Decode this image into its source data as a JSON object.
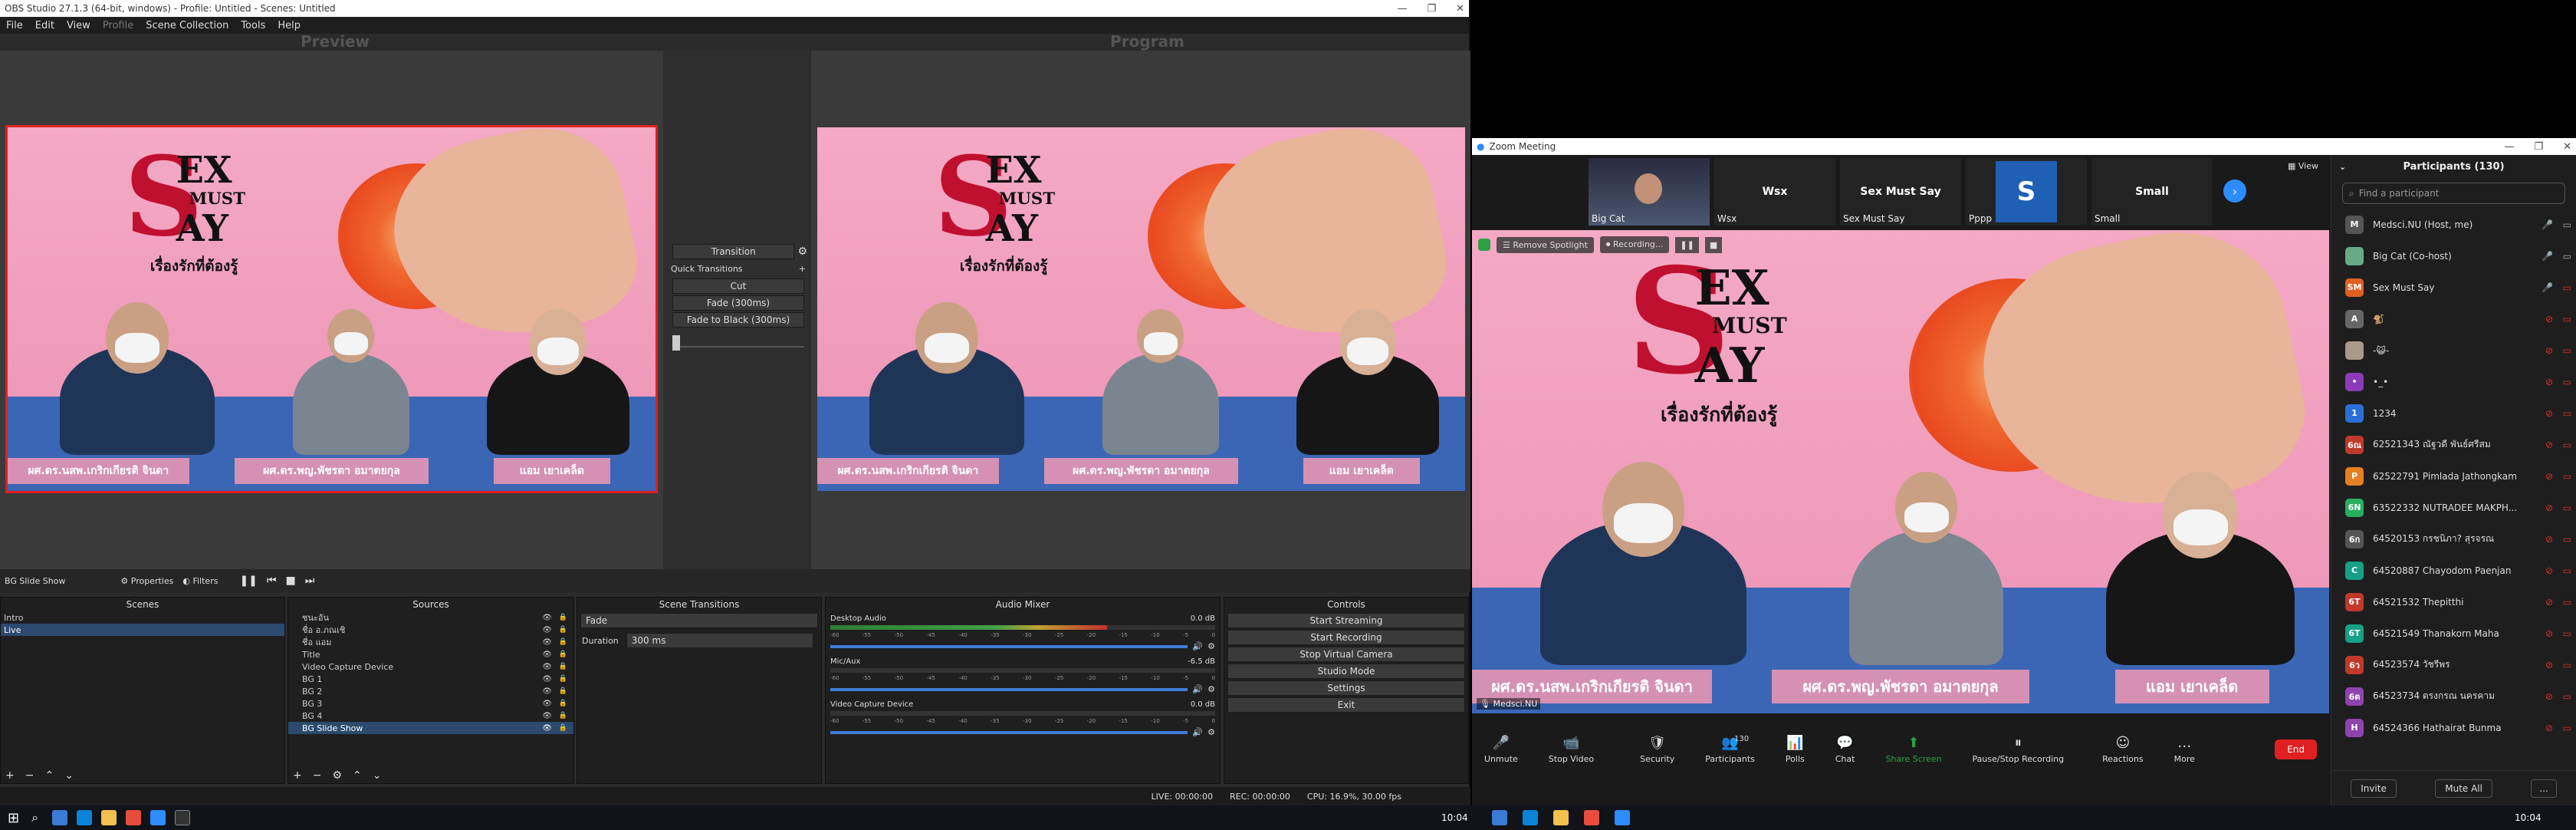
{
  "obs": {
    "window_title": "OBS Studio 27.1.3 (64-bit, windows) - Profile: Untitled - Scenes: Untitled",
    "menu": [
      "File",
      "Edit",
      "View",
      "Profile",
      "Scene Collection",
      "Tools",
      "Help"
    ],
    "preview_label": "Preview",
    "program_label": "Program",
    "transition_panel": {
      "transition_label": "Transition",
      "quick_transitions_label": "Quick Transitions",
      "cut_label": "Cut",
      "fade_label": "Fade (300ms)",
      "fade_black_label": "Fade to Black (300ms)"
    },
    "source_toolbar": {
      "source_name": "BG Slide Show",
      "properties_label": "Properties",
      "filters_label": "Filters"
    },
    "scenes": {
      "title": "Scenes",
      "items": [
        "Intro",
        "Live"
      ],
      "selected": 1
    },
    "sources": {
      "title": "Sources",
      "items": [
        "ชนะอัน",
        "ชื่อ อ.ภณเชิ",
        "ชื่อ แอม",
        "Title",
        "Video Capture Device",
        "BG 1",
        "BG 2",
        "BG 3",
        "BG 4",
        "BG Slide Show"
      ],
      "selected": 9
    },
    "scene_transitions": {
      "title": "Scene Transitions",
      "type": "Fade",
      "duration_label": "Duration",
      "duration_value": "300 ms"
    },
    "audio_mixer": {
      "title": "Audio Mixer",
      "channels": [
        {
          "name": "Desktop Audio",
          "db": "0.0 dB",
          "level": 0.72
        },
        {
          "name": "Mic/Aux",
          "db": "-6.5 dB",
          "level": 0.0
        },
        {
          "name": "Video Capture Device",
          "db": "0.0 dB",
          "level": 0.0
        }
      ],
      "ticks": [
        "-60",
        "-55",
        "-50",
        "-45",
        "-40",
        "-35",
        "-30",
        "-25",
        "-20",
        "-15",
        "-10",
        "-5",
        "0"
      ]
    },
    "controls": {
      "title": "Controls",
      "buttons": [
        "Start Streaming",
        "Start Recording",
        "Stop Virtual Camera",
        "Studio Mode",
        "Settings",
        "Exit"
      ]
    },
    "status": {
      "live": "LIVE: 00:00:00",
      "rec": "REC: 00:00:00",
      "cpu": "CPU: 16.9%, 30.00 fps"
    }
  },
  "scene_content": {
    "logo_s": "S",
    "logo_ex": "EX",
    "logo_must": "MUST",
    "logo_ay": "AY",
    "tagline": "เรื่องรักที่ต้องรู้",
    "lower_thirds": [
      "ผศ.ดร.นสพ.เกริกเกียรติ จินดา",
      "ผศ.ดร.พญ.พัชรดา อมาตยกุล",
      "แอม เยาเคล็ด"
    ]
  },
  "zoom": {
    "window_title": "Zoom Meeting",
    "view_label": "View",
    "thumbnails": [
      {
        "name": "Big Cat",
        "type": "video"
      },
      {
        "name": "Wsx",
        "label": "Wsx"
      },
      {
        "name": "Sex Must Say",
        "label": "Sex Must Say"
      },
      {
        "name": "Pppp",
        "letter": "S"
      },
      {
        "name": "Small",
        "label": "Small"
      }
    ],
    "spotlight_label": "Remove Spotlight",
    "recording_label": "Recording...",
    "self_name": "Medsci.NU",
    "toolbar": [
      "Unmute",
      "Stop Video",
      "Security",
      "Participants",
      "Polls",
      "Chat",
      "Share Screen",
      "Pause/Stop Recording",
      "Reactions",
      "More"
    ],
    "participants_count": "130",
    "end_label": "End",
    "participants_panel": {
      "title": "Participants (130)",
      "search_placeholder": "Find a participant",
      "items": [
        {
          "initial": "M",
          "name": "Medsci.NU (Host, me)",
          "color": "#555"
        },
        {
          "initial": "",
          "name": "Big Cat (Co-host)",
          "color": "#6a8"
        },
        {
          "initial": "SM",
          "name": "Sex Must Say",
          "color": "#e06020"
        },
        {
          "initial": "A",
          "name": "🐒",
          "color": "#666"
        },
        {
          "initial": "",
          "name": "-😺-",
          "color": "#a98"
        },
        {
          "initial": "•",
          "name": "•_•",
          "color": "#8b3ab8"
        },
        {
          "initial": "1",
          "name": "1234",
          "color": "#2a6fd6"
        },
        {
          "initial": "6ณ",
          "name": "62521343 ณัฐวดี พันธ์ศรีสม",
          "color": "#c0392b"
        },
        {
          "initial": "P",
          "name": "62522791 Pimlada Jathongkam",
          "color": "#e67e22"
        },
        {
          "initial": "6N",
          "name": "63522332 NUTRADEE MAKPH...",
          "color": "#27ae60"
        },
        {
          "initial": "6ก",
          "name": "64520153 กรชนิภา? สุรจรณ",
          "color": "#555"
        },
        {
          "initial": "C",
          "name": "64520887 Chayodom Paenjan",
          "color": "#16a085"
        },
        {
          "initial": "6T",
          "name": "64521532 Thepitthi",
          "color": "#c0392b"
        },
        {
          "initial": "6T",
          "name": "64521549 Thanakorn Maha",
          "color": "#16a085"
        },
        {
          "initial": "6ว",
          "name": "64523574 วัชรีพร",
          "color": "#c0392b"
        },
        {
          "initial": "6ต",
          "name": "64523734 ตรงกรณ นครคาม",
          "color": "#8e44ad"
        },
        {
          "initial": "H",
          "name": "64524366 Hathairat Bunma",
          "color": "#8e44ad"
        }
      ],
      "invite_label": "Invite",
      "mute_all_label": "Mute All",
      "more_label": "..."
    }
  },
  "taskbar": {
    "time_left": "10:04",
    "time_right": "10:04"
  }
}
